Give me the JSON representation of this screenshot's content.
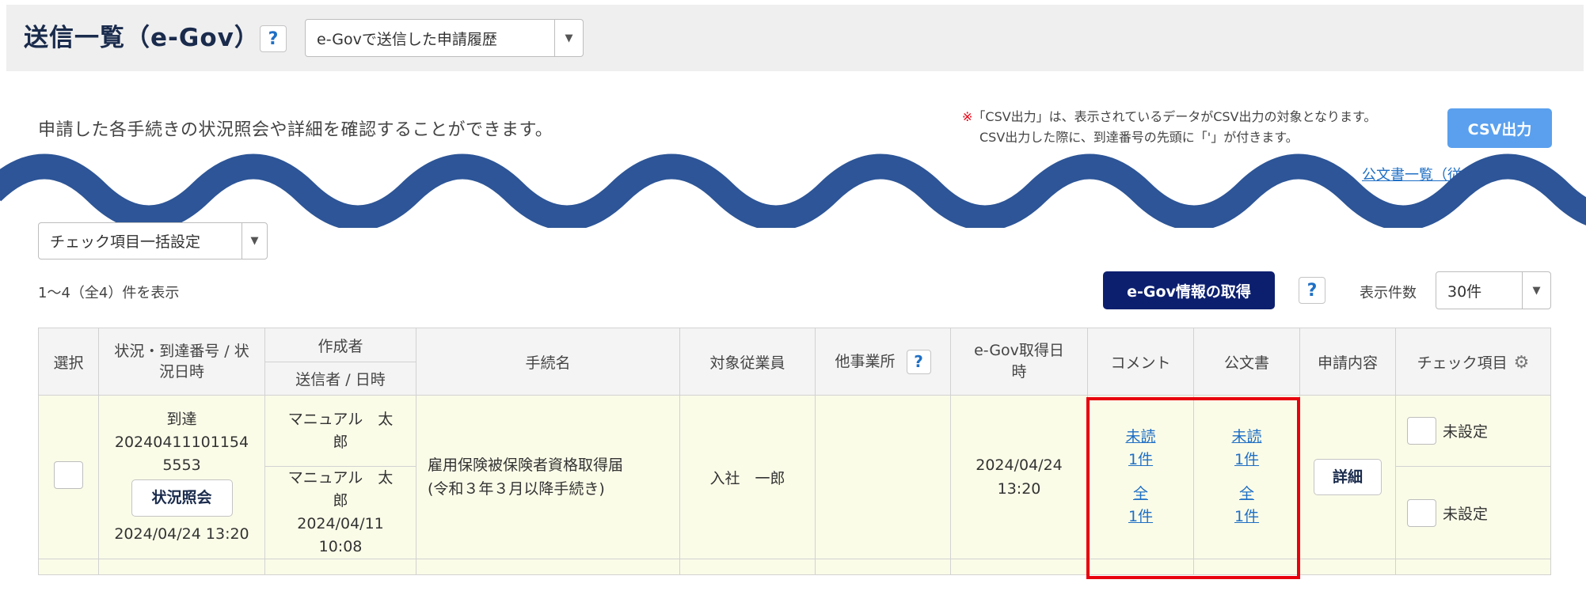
{
  "header": {
    "title": "送信一覧（e-Gov）",
    "help_icon": "?",
    "history_select": "e-Govで送信した申請履歴"
  },
  "notice": {
    "description": "申請した各手続きの状況照会や詳細を確認することができます。",
    "csv_mark": "※",
    "csv_note_line1": "「CSV出力」は、表示されているデータがCSV出力の対象となります。",
    "csv_note_line2": "CSV出力した際に、到達番号の先頭に「'」が付きます。",
    "csv_button": "CSV出力",
    "partial_link": "公文書一覧（従"
  },
  "toolbar": {
    "bulk_check_select": "チェック項目一括設定",
    "count_text": "1～4（全4）件を表示",
    "egov_fetch_button": "e-Gov情報の取得",
    "help_icon": "?",
    "per_page_label": "表示件数",
    "per_page_value": "30件"
  },
  "table": {
    "headers": {
      "select": "選択",
      "status": "状況・到達番号 / 状況日時",
      "creator": "作成者",
      "sender": "送信者 / 日時",
      "procedure": "手続名",
      "employee": "対象従業員",
      "other_office": "他事業所",
      "other_office_help": "?",
      "egov_date": "e-Gov取得日時",
      "comment": "コメント",
      "official_doc": "公文書",
      "application": "申請内容",
      "check_items": "チェック項目"
    },
    "row": {
      "status": "到達",
      "arrival_no": "202404111011545553",
      "status_inquiry_button": "状況照会",
      "status_datetime": "2024/04/24 13:20",
      "creator": "マニュアル　太郎",
      "sender": "マニュアル　太郎",
      "sent_datetime": "2024/04/11 10:08",
      "procedure_line1": "雇用保険被保険者資格取得届",
      "procedure_line2": "(令和３年３月以降手続き)",
      "employee": "入社　一郎",
      "egov_date": "2024/04/24 13:20",
      "comment_unread": "未読",
      "comment_unread_count": "1件",
      "comment_all": "全",
      "comment_all_count": "1件",
      "doc_unread": "未読",
      "doc_unread_count": "1件",
      "doc_all": "全",
      "doc_all_count": "1件",
      "detail_button": "詳細",
      "check1_label": "未設定",
      "check2_label": "未設定"
    }
  },
  "colors": {
    "title": "#1a2b4c",
    "primary_button": "#0c1f6f",
    "csv_button": "#5aa0ee",
    "link": "#1f6fc5",
    "row_bg": "#fbfce8",
    "highlight_frame": "#e8000e",
    "wave": "#2d5597"
  }
}
